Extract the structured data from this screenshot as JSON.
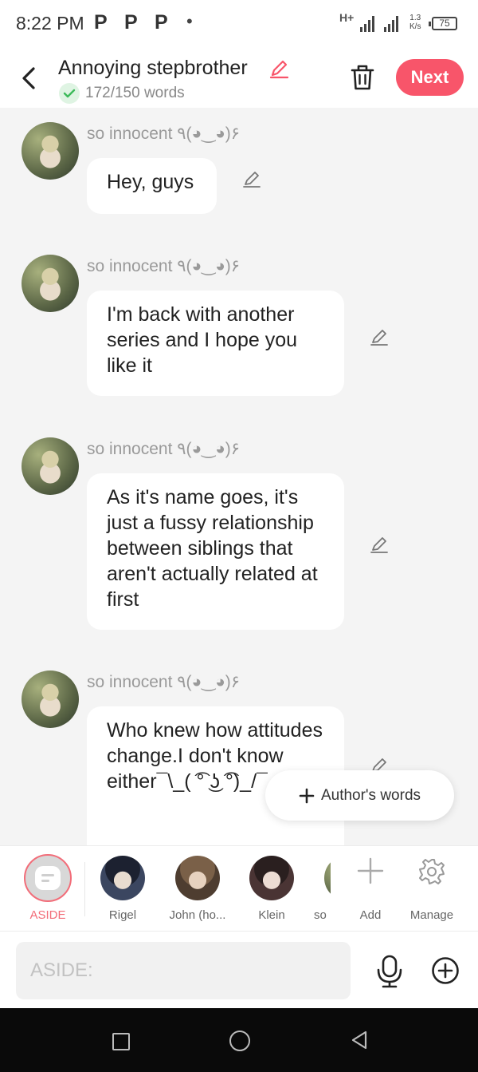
{
  "status_bar": {
    "time": "8:22 PM",
    "p_icons": [
      "P",
      "P",
      "P"
    ],
    "network": "H+",
    "speed_value": "1.3",
    "speed_unit": "K/s",
    "battery": "75"
  },
  "header": {
    "title": "Annoying stepbrother",
    "word_count": "172/150 words",
    "next_label": "Next"
  },
  "messages": [
    {
      "author": "so innocent ٩(◕‿◕)۶",
      "text": "Hey, guys"
    },
    {
      "author": "so innocent ٩(◕‿◕)۶",
      "text": "I'm back with another series and I hope you like it"
    },
    {
      "author": "so innocent ٩(◕‿◕)۶",
      "text": "As it's name goes, it's just a fussy relationship between siblings that aren't actually related at first"
    },
    {
      "author": "so innocent ٩(◕‿◕)۶",
      "text": "Who knew how attitudes change.I don't know either¯\\_( ͡° ͜ʖ ͡°)_/¯"
    }
  ],
  "authors_words": {
    "label": "Author's words"
  },
  "character_bar": {
    "aside_label": "ASIDE",
    "characters": [
      {
        "name": "Rigel",
        "color": "#3b4660"
      },
      {
        "name": "John (ho...",
        "color": "#6d5a48"
      },
      {
        "name": "Klein",
        "color": "#3a2c2c"
      },
      {
        "name": "so i",
        "color": "#5b6646"
      }
    ],
    "add_label": "Add",
    "manage_label": "Manage"
  },
  "input": {
    "placeholder": "ASIDE:"
  },
  "colors": {
    "accent": "#f8556a",
    "aside_red": "#f26d79",
    "check_green": "#3cba5a"
  }
}
